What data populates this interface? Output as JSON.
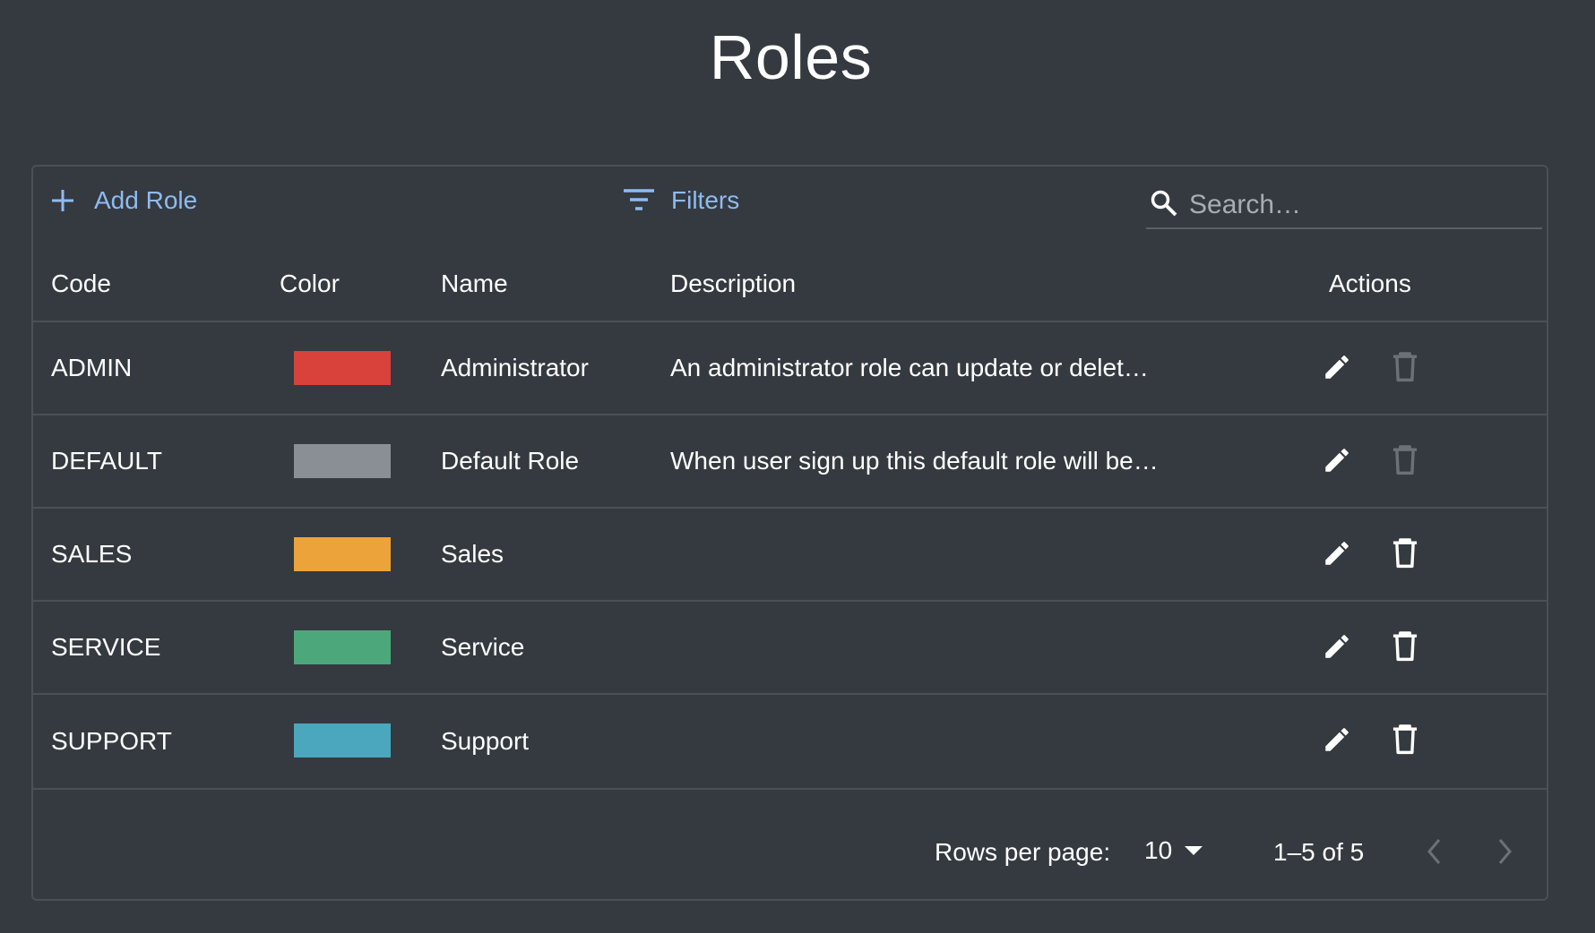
{
  "page": {
    "title": "Roles"
  },
  "toolbar": {
    "add_label": "Add Role",
    "filters_label": "Filters",
    "search_placeholder": "Search…",
    "search_value": "",
    "accent_color": "#8fbbf0"
  },
  "table": {
    "columns": [
      "Code",
      "Color",
      "Name",
      "Description",
      "Actions"
    ],
    "rows": [
      {
        "code": "ADMIN",
        "color": "#d9423b",
        "name": "Administrator",
        "description": "An administrator role can update or delet…",
        "delete_enabled": false
      },
      {
        "code": "DEFAULT",
        "color": "#8a8f96",
        "name": "Default Role",
        "description": "When user sign up this default role will be…",
        "delete_enabled": false
      },
      {
        "code": "SALES",
        "color": "#eca33a",
        "name": "Sales",
        "description": "",
        "delete_enabled": true
      },
      {
        "code": "SERVICE",
        "color": "#4ca87a",
        "name": "Service",
        "description": "",
        "delete_enabled": true
      },
      {
        "code": "SUPPORT",
        "color": "#4ba7bd",
        "name": "Support",
        "description": "",
        "delete_enabled": true
      }
    ]
  },
  "footer": {
    "rows_per_page_label": "Rows per page:",
    "rows_per_page_value": "10",
    "range_label": "1–5 of 5",
    "prev_enabled": false,
    "next_enabled": false
  },
  "icons": {
    "add": "plus-icon",
    "filters": "filter-icon",
    "search": "search-icon",
    "edit": "pencil-icon",
    "delete": "trash-icon",
    "dropdown": "caret-down-icon",
    "prev": "chevron-left-icon",
    "next": "chevron-right-icon"
  }
}
